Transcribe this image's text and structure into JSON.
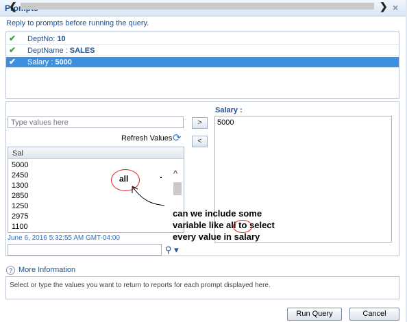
{
  "dialog": {
    "title": "Prompts",
    "close_glyph": "×",
    "instruction": "Reply to prompts before running the query."
  },
  "prompts": [
    {
      "label": "DeptNo:",
      "value": "10",
      "answered": true,
      "selected": false
    },
    {
      "label": "DeptName :",
      "value": "SALES",
      "answered": true,
      "selected": false
    },
    {
      "label": "Salary :",
      "value": "5000",
      "answered": true,
      "selected": true
    }
  ],
  "value_entry": {
    "placeholder": "Type values here",
    "refresh_label": "Refresh Values",
    "list_header": "Sal",
    "values": [
      "5000",
      "2450",
      "1300",
      "2850",
      "1250",
      "2975",
      "1100"
    ],
    "timestamp": "June 6, 2016 5:32:55 AM GMT-04:00"
  },
  "selected_panel": {
    "label": "Salary :",
    "values": [
      "5000"
    ]
  },
  "annotation": {
    "word": "all",
    "question_lines": [
      "can we include some",
      "variable like all to select",
      "every value in salary"
    ]
  },
  "footer": {
    "more_info": "More Information",
    "help_text": "Select or type the values you want to return to reports for each prompt displayed here.",
    "run_query": "Run Query",
    "cancel": "Cancel"
  },
  "colors": {
    "accent": "#3d8fe0",
    "title": "#1f4e8c",
    "check": "#3aa43a",
    "annotation": "#e02020"
  }
}
